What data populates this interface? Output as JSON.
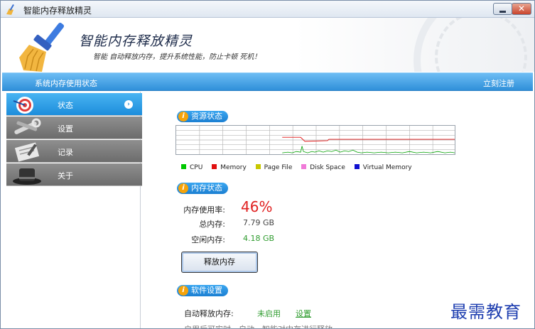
{
  "window": {
    "title": "智能内存释放精灵"
  },
  "header": {
    "app_name": "智能内存释放精灵",
    "slogan": "智能 自动释放内存，提升系统性能，防止卡顿 死机！"
  },
  "bluebar": {
    "left_text": "系统内存使用状态",
    "right_text": "立刻注册"
  },
  "sidebar": {
    "items": [
      {
        "label": "状态",
        "icon": "target-icon",
        "active": true
      },
      {
        "label": "设置",
        "icon": "tools-icon",
        "active": false
      },
      {
        "label": "记录",
        "icon": "clipboard-icon",
        "active": false
      },
      {
        "label": "关于",
        "icon": "hat-icon",
        "active": false
      }
    ]
  },
  "resource": {
    "title": "资源状态",
    "legend": [
      {
        "label": "CPU",
        "color": "#00c800"
      },
      {
        "label": "Memory",
        "color": "#e01010"
      },
      {
        "label": "Page File",
        "color": "#c8c800"
      },
      {
        "label": "Disk Space",
        "color": "#f07ad8"
      },
      {
        "label": "Virtual Memory",
        "color": "#1010d0"
      }
    ]
  },
  "memory": {
    "title": "内存状态",
    "usage_label": "内存使用率:",
    "usage_value": "46%",
    "usage_fraction": 0.46,
    "total_label": "总内存:",
    "total_value": "7.79 GB",
    "free_label": "空闲内存:",
    "free_value": "4.18 GB",
    "release_button": "释放内存"
  },
  "software": {
    "title": "软件设置",
    "auto_label": "自动释放内存:",
    "auto_status": "未启用",
    "settings_link": "设置",
    "hint": "启用后可实时，自动，智能对内存进行释放。"
  },
  "watermark": "最需教育"
}
